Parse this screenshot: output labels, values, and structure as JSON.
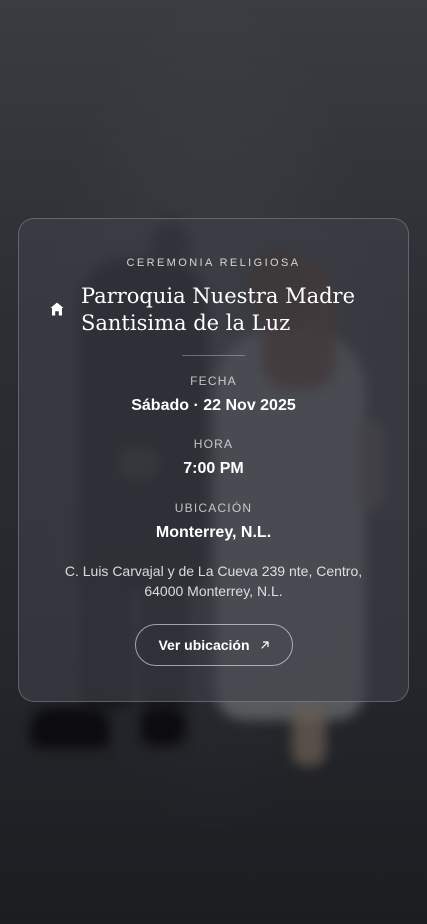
{
  "ceremony": {
    "eyebrow": "CEREMONIA RELIGIOSA",
    "venue_line1": "Parroquia Nuestra Madre",
    "venue_line2": "Santisima de la Luz",
    "venue_icon": "home-icon",
    "date_label": "FECHA",
    "date_value": "Sábado · 22 Nov 2025",
    "time_label": "HORA",
    "time_value": "7:00 PM",
    "location_label": "UBICACIÓN",
    "location_value": "Monterrey, N.L.",
    "address_line1": "C. Luis Carvajal y de La Cueva 239 nte, Centro,",
    "address_line2": "64000 Monterrey, N.L.",
    "button_label": "Ver ubicación",
    "button_icon": "arrow-up-right-icon"
  },
  "colors": {
    "card_bg": "#3e4048",
    "text": "#ffffff",
    "muted": "#b3b3b3"
  }
}
